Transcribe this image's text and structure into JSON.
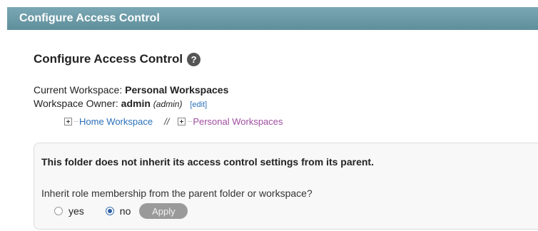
{
  "titlebar": {
    "title": "Configure Access Control"
  },
  "heading": {
    "title": "Configure Access Control",
    "help_glyph": "?"
  },
  "workspace": {
    "current_label": "Current Workspace: ",
    "current_value": "Personal Workspaces",
    "owner_label": "Workspace Owner: ",
    "owner_name": "admin",
    "owner_id": "(admin)",
    "edit_link": "[edit]"
  },
  "breadcrumbs": {
    "items": [
      "Home Workspace",
      "Personal Workspaces"
    ],
    "separator": "//",
    "dots": "···"
  },
  "panel": {
    "message": "This folder does not inherit its access control settings from its parent.",
    "question": "Inherit role membership from the parent folder or workspace?",
    "options": [
      {
        "label": "yes",
        "checked": false
      },
      {
        "label": "no",
        "checked": true
      }
    ],
    "apply_label": "Apply"
  },
  "colors": {
    "titlebar": "#6a99a6",
    "link": "#2a6fb8",
    "visited_link": "#a04da0",
    "button": "#9a9a9a"
  },
  "icons": [
    "help-icon",
    "expand-plus-icon",
    "radio-icon"
  ]
}
